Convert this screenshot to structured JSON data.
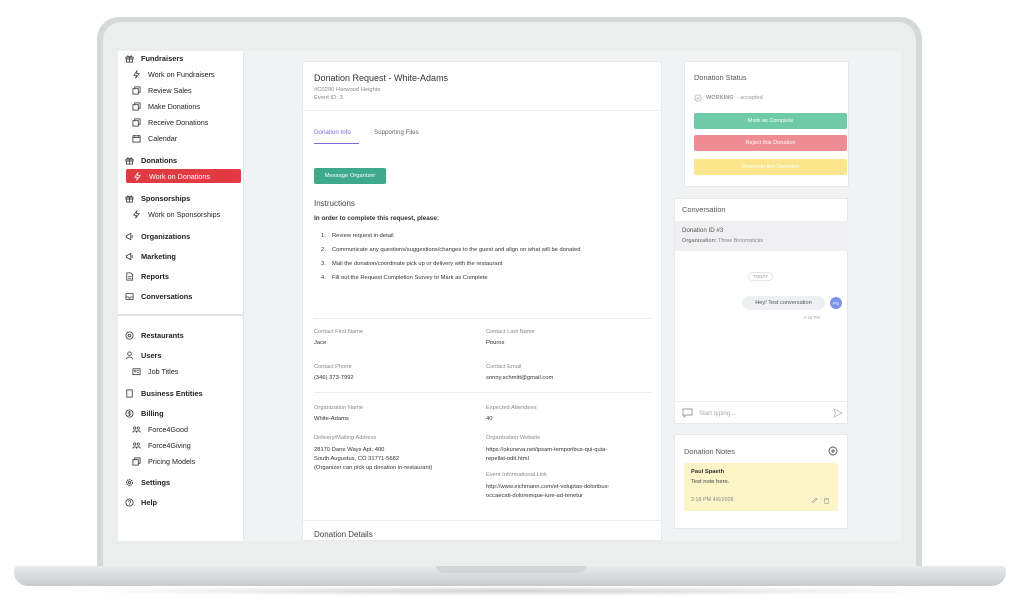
{
  "sidebar": {
    "items": [
      {
        "label": "Fundraisers",
        "icon": "gift-icon",
        "level": "top"
      },
      {
        "label": "Work on Fundraisers",
        "icon": "bolt-icon",
        "level": "sub"
      },
      {
        "label": "Review Sales",
        "icon": "copy-icon",
        "level": "sub"
      },
      {
        "label": "Make Donations",
        "icon": "copy-icon",
        "level": "sub"
      },
      {
        "label": "Receive Donations",
        "icon": "copy-icon",
        "level": "sub"
      },
      {
        "label": "Calendar",
        "icon": "calendar-icon",
        "level": "sub"
      },
      {
        "label": "Donations",
        "icon": "gift-icon",
        "level": "top"
      },
      {
        "label": "Work on Donations",
        "icon": "bolt-icon",
        "level": "sub",
        "active": true
      },
      {
        "label": "Sponsorships",
        "icon": "gift-icon",
        "level": "top"
      },
      {
        "label": "Work on Sponsorships",
        "icon": "bolt-icon",
        "level": "sub"
      },
      {
        "label": "Organizations",
        "icon": "megaphone-icon",
        "level": "top"
      },
      {
        "label": "Marketing",
        "icon": "megaphone-icon",
        "level": "top"
      },
      {
        "label": "Reports",
        "icon": "document-icon",
        "level": "top"
      },
      {
        "label": "Conversations",
        "icon": "inbox-icon",
        "level": "top"
      },
      {
        "label": "Restaurants",
        "icon": "location-icon",
        "level": "top"
      },
      {
        "label": "Users",
        "icon": "user-icon",
        "level": "top"
      },
      {
        "label": "Job Titles",
        "icon": "id-card-icon",
        "level": "sub"
      },
      {
        "label": "Business Entities",
        "icon": "building-icon",
        "level": "top"
      },
      {
        "label": "Billing",
        "icon": "dollar-icon",
        "level": "top"
      },
      {
        "label": "Force4Good",
        "icon": "people-icon",
        "level": "sub"
      },
      {
        "label": "Force4Giving",
        "icon": "people-icon",
        "level": "sub"
      },
      {
        "label": "Pricing Models",
        "icon": "copy-icon",
        "level": "sub"
      },
      {
        "label": "Settings",
        "icon": "gear-icon",
        "level": "top"
      },
      {
        "label": "Help",
        "icon": "help-icon",
        "level": "top"
      }
    ]
  },
  "request": {
    "title": "Donation Request - White-Adams",
    "address": "#C0290 Harwood Heights",
    "event_id": "Event ID: 3",
    "tabs": [
      "Donation Info",
      "Supporting Files"
    ],
    "message_button": "Message Organizer",
    "instructions_heading": "Instructions",
    "instructions_intro": "In order to complete this request, please:",
    "steps": [
      {
        "n": "1.",
        "text": "Review request in detail"
      },
      {
        "n": "2.",
        "text": "Communicate any questions/suggestions/changes to the guest and align on what will be donated"
      },
      {
        "n": "3.",
        "text": "Mail the donation/coordinate pick up or delivery with the restaurant"
      },
      {
        "n": "4.",
        "text": "Fill out the Request Completion Survey to Mark as Complete"
      }
    ],
    "fields": {
      "first_name_label": "Contact First Name",
      "first_name": "Jace",
      "last_name_label": "Contact Last Name",
      "last_name": "Pouros",
      "phone_label": "Contact Phone",
      "phone": "(346) 373-7992",
      "email_label": "Contact Email",
      "email": "sonny.schmitt@gmail.com",
      "org_name_label": "Organization Name",
      "org_name": "White-Adams",
      "attendees_label": "Expected Attendees",
      "attendees": "40",
      "address_label": "Delivery/Mailing Address",
      "address_line1": "28170 Dane Ways Apt. 400",
      "address_line2": "South Augustus, CO 31771-5682",
      "address_line3": "(Organizer can pick up donation in-restaurant)",
      "website_label": "Organization Website",
      "website_line1": "https://okuneva.net/ipsam-temporibus-qui-quia-",
      "website_line2": "repellat-odit.html",
      "event_link_label": "Event Informational Link",
      "event_link_line1": "http://www.eichmann.com/et-voluptas-doloribus-",
      "event_link_line2": "occaecati-doloremque-iure-ad-tenetur"
    },
    "details_heading": "Donation Details"
  },
  "status": {
    "title": "Donation Status",
    "state": "WORKING",
    "sub_state": "- accepted",
    "complete_button": "Mark as Complete",
    "reject_button": "Reject this Donation",
    "reassign_button": "Reassign this Donation",
    "colors": {
      "complete": "#6fcaa8",
      "reject": "#ef8c93",
      "reassign": "#fbe68e"
    }
  },
  "conversation": {
    "title": "Conversation",
    "donation_id": "Donation ID #3",
    "org_label": "Organization:",
    "org_name": "Three Broomsticks",
    "day_chip": "TODAY",
    "message": "Hey! Test conversation",
    "avatar_initials": "PS",
    "message_time": "2:18 PM",
    "input_placeholder": "Start typing..."
  },
  "notes": {
    "title": "Donation Notes",
    "author": "Paul Spaeth",
    "text": "Test note here.",
    "timestamp": "2:18 PM 4/6/2026"
  },
  "colors": {
    "accent": "#e23a43",
    "primary": "#3fa98b",
    "tab_accent": "#7e6cd6"
  }
}
